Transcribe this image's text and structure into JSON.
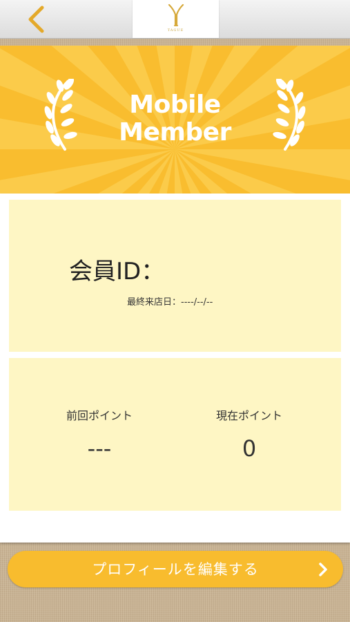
{
  "header": {
    "back_icon": "chevron-left-icon",
    "logo_text": "TAGUE",
    "accent_color": "#e4a92a"
  },
  "banner": {
    "title_line1": "Mobile",
    "title_line2": "Member",
    "decoration_icon": "laurel-icon",
    "background_color": "#f9bd2f"
  },
  "member": {
    "id_label": "会員ID：",
    "last_visit": "最終来店日：----/--/--"
  },
  "points": {
    "previous_label": "前回ポイント",
    "previous_value": "---",
    "current_label": "現在ポイント",
    "current_value": "0"
  },
  "actions": {
    "edit_profile_label": "プロフィールを編集する",
    "edit_profile_icon": "chevron-right-icon",
    "button_color": "#f8bc2e"
  }
}
